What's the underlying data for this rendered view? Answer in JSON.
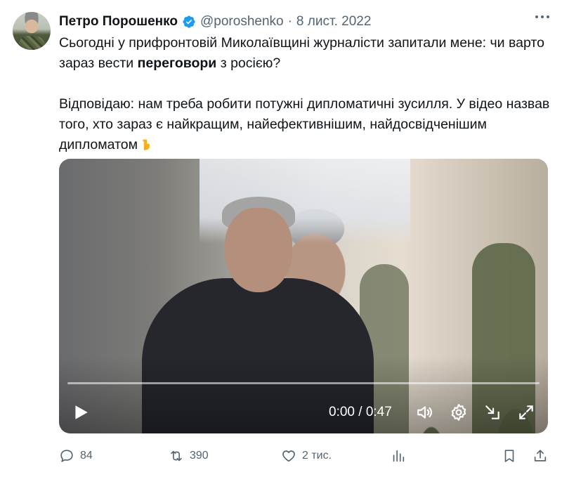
{
  "author": {
    "name": "Петро Порошенко",
    "handle": "@poroshenko",
    "separator": "·",
    "date": "8 лист. 2022"
  },
  "tweet": {
    "p1_a": "Сьогодні у прифронтовій Миколаївщині журналісти запитали мене: чи варто зараз вести ",
    "p1_bold": "переговори",
    "p1_b": " з росією?",
    "p2": "Відповідаю: нам треба робити потужні дипломатичні зусилля. У відео назвав того, хто зараз є найкращим, найефективнішим, найдосвідченішим дипломатом",
    "emoji": "pointing-down-hand"
  },
  "video": {
    "time": "0:00 / 0:47",
    "progress": 0
  },
  "actions": {
    "replies": "84",
    "reposts": "390",
    "likes": "2 тис."
  },
  "colors": {
    "verified": "#1d9bf0",
    "text": "#0f1419",
    "muted": "#536471"
  }
}
